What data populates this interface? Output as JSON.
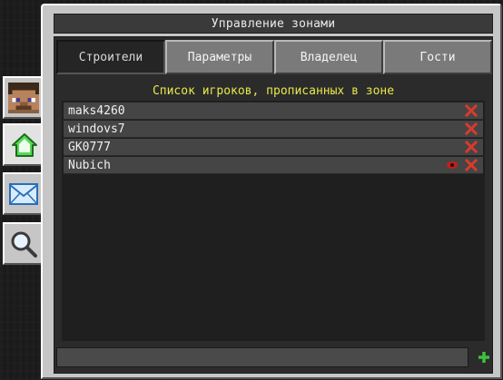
{
  "window": {
    "title": "Управление зонами"
  },
  "tabs": [
    {
      "label": "Строители",
      "active": true
    },
    {
      "label": "Параметры",
      "active": false
    },
    {
      "label": "Владелец",
      "active": false
    },
    {
      "label": "Гости",
      "active": false
    }
  ],
  "list": {
    "title": "Список игроков, прописанных в зоне",
    "players": [
      {
        "name": "maks4260",
        "has_eye_icon": false
      },
      {
        "name": "windovs7",
        "has_eye_icon": false
      },
      {
        "name": "GK0777",
        "has_eye_icon": false
      },
      {
        "name": "Nubich",
        "has_eye_icon": true
      }
    ]
  },
  "input": {
    "value": ""
  },
  "side_tabs": [
    "player-head-icon",
    "home-icon",
    "mail-icon",
    "magnifier-icon"
  ],
  "colors": {
    "accent_yellow": "#e8e84a",
    "delete_red": "#d93a2b",
    "add_green": "#3fbf3f"
  }
}
